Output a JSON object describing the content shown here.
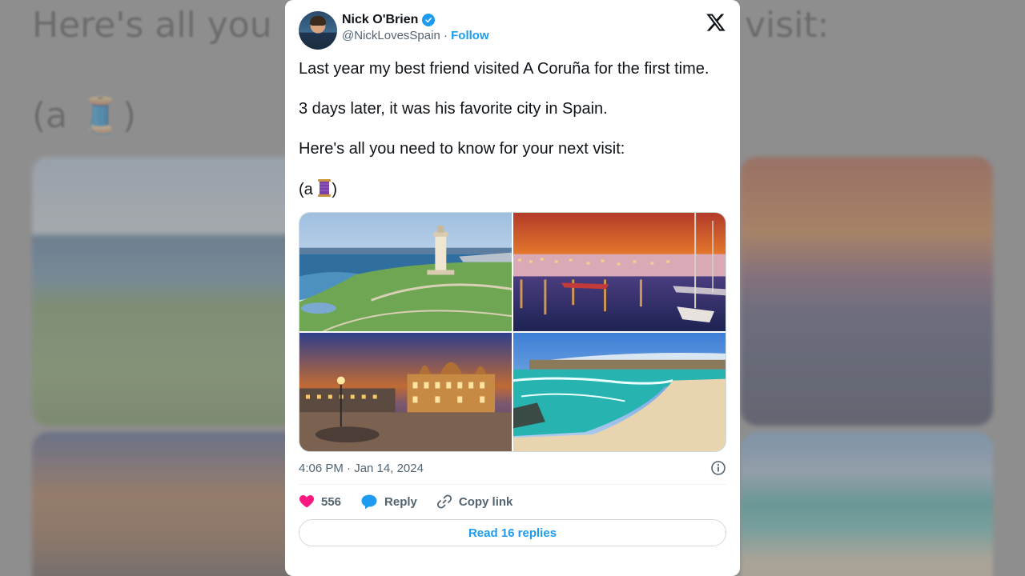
{
  "background": {
    "line1_left": "Here's all you n",
    "line1_right": "visit:",
    "line2": "(a 🧵)"
  },
  "author": {
    "name": "Nick O'Brien",
    "handle": "@NickLovesSpain",
    "separator": "·",
    "follow_label": "Follow"
  },
  "tweet": {
    "paragraphs": [
      "Last year my best friend visited A Coruña for the first time.",
      "3 days later, it was his favorite city in Spain.",
      "Here's all you need to know for your next visit:"
    ],
    "thread_open": "(a ",
    "thread_close": ")",
    "timestamp": "4:06 PM · Jan 14, 2024"
  },
  "media": [
    {
      "subject": "lighthouse-on-coast"
    },
    {
      "subject": "marina-at-sunset"
    },
    {
      "subject": "city-hall-at-dusk"
    },
    {
      "subject": "turquoise-beach"
    }
  ],
  "actions": {
    "likes": "556",
    "reply_label": "Reply",
    "copy_label": "Copy link"
  },
  "read_replies_label": "Read 16 replies",
  "colors": {
    "accent": "#1d9bf0",
    "like": "#f91880",
    "text": "#0f1419",
    "muted": "#536471"
  },
  "icons": [
    "verified-badge-icon",
    "x-logo-icon",
    "info-icon",
    "heart-icon",
    "reply-bubble-icon",
    "link-icon",
    "thread-spool-icon"
  ]
}
